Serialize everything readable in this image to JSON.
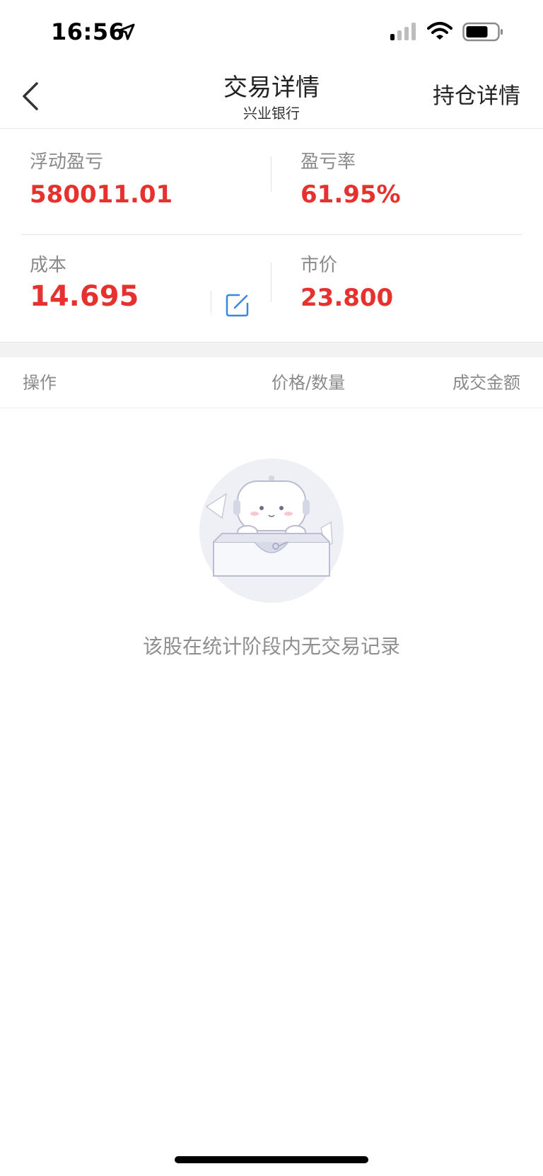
{
  "status_bar": {
    "time": "16:56"
  },
  "nav": {
    "title": "交易详情",
    "subtitle": "兴业银行",
    "right_button": "持仓详情"
  },
  "summary": {
    "floating_pl": {
      "label": "浮动盈亏",
      "value": "580011.01"
    },
    "pl_rate": {
      "label": "盈亏率",
      "value": "61.95%"
    },
    "cost": {
      "label": "成本",
      "value": "14.695"
    },
    "market_price": {
      "label": "市价",
      "value": "23.800"
    }
  },
  "table": {
    "headers": [
      "操作",
      "价格/数量",
      "成交金额"
    ]
  },
  "empty_state": {
    "message": "该股在统计阶段内无交易记录"
  },
  "colors": {
    "positive": "#e6322e",
    "accent": "#3b86e0"
  }
}
